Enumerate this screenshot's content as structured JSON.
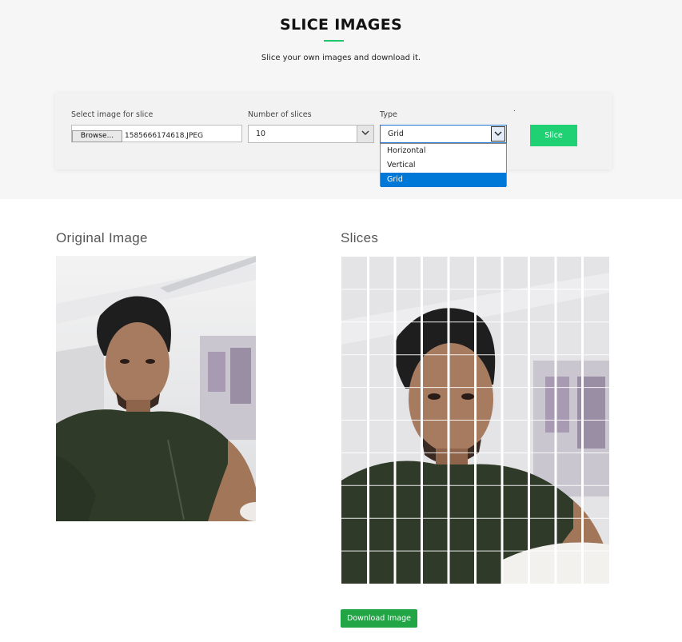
{
  "header": {
    "title": "SLICE IMAGES",
    "subtitle": "Slice your own images and download it."
  },
  "form": {
    "file_label": "Select image for slice",
    "browse_label": "Browse...",
    "file_name": "1585666174618.JPEG",
    "slices_label": "Number of slices",
    "slices_value": "10",
    "type_label": "Type",
    "type_value": "Grid",
    "type_options": [
      "Horizontal",
      "Vertical",
      "Grid"
    ],
    "type_selected_index": 2,
    "mark": ".",
    "slice_button": "Slice"
  },
  "results": {
    "original_title": "Original Image",
    "slices_title": "Slices",
    "download_button": "Download Image",
    "grid_columns": 10,
    "grid_rows": 10
  },
  "colors": {
    "accent_green": "#1fd173",
    "download_green": "#21a545",
    "dropdown_selected": "#0078d7",
    "hero_bg": "#f6f6f6"
  },
  "icons": {
    "select_arrow": "chevron-down-icon"
  }
}
